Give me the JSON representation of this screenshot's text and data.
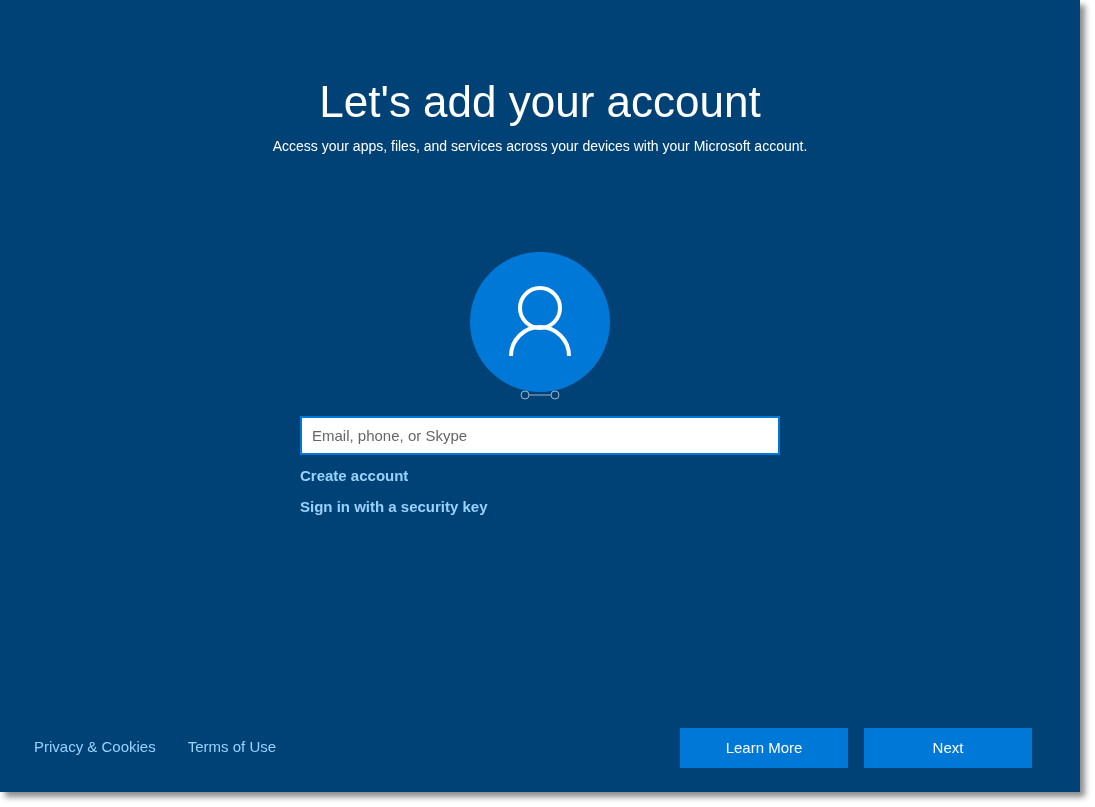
{
  "title": "Let's add your account",
  "subtitle": "Access your apps, files, and services across your devices with your Microsoft account.",
  "account_field": {
    "placeholder": "Email, phone, or Skype"
  },
  "links": [
    "Create account",
    "Sign in with a security key"
  ],
  "footer_links": [
    "Privacy & Cookies",
    "Terms of Use"
  ],
  "buttons": [
    "Learn More",
    "Next"
  ]
}
